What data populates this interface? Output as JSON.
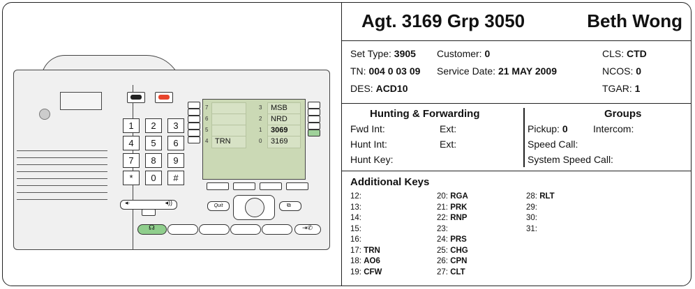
{
  "header": {
    "agent": "Agt. 3169 Grp 3050",
    "name": "Beth Wong"
  },
  "setinfo": {
    "set_type_label": "Set Type: ",
    "set_type": "3905",
    "customer_label": "Customer: ",
    "customer": "0",
    "cls_label": "CLS: ",
    "cls": "CTD",
    "tn_label": "TN: ",
    "tn": "004 0 03 09",
    "service_date_label": "Service Date: ",
    "service_date": "21 MAY 2009",
    "ncos_label": "NCOS: ",
    "ncos": "0",
    "des_label": "DES: ",
    "des": "ACD10",
    "tgar_label": "TGAR: ",
    "tgar": "1"
  },
  "hunting": {
    "title": "Hunting & Forwarding",
    "fwd_int": "Fwd  Int:",
    "fwd_ext": "Ext:",
    "hunt_int": "Hunt Int:",
    "hunt_ext": "Ext:",
    "hunt_key": "Hunt Key:"
  },
  "groups": {
    "title": "Groups",
    "pickup_label": "Pickup: ",
    "pickup": "0",
    "intercom": "Intercom:",
    "speed_call": "Speed Call:",
    "system_speed_call": "System Speed Call:"
  },
  "additional_keys": {
    "title": "Additional Keys",
    "col1": [
      {
        "n": "12:",
        "v": ""
      },
      {
        "n": "13:",
        "v": ""
      },
      {
        "n": "14:",
        "v": ""
      },
      {
        "n": "15:",
        "v": ""
      },
      {
        "n": "16:",
        "v": ""
      },
      {
        "n": "17: ",
        "v": "TRN"
      },
      {
        "n": "18: ",
        "v": "AO6"
      },
      {
        "n": "19: ",
        "v": "CFW"
      }
    ],
    "col2": [
      {
        "n": "20: ",
        "v": "RGA"
      },
      {
        "n": "21: ",
        "v": "PRK"
      },
      {
        "n": "22: ",
        "v": "RNP"
      },
      {
        "n": "23:",
        "v": ""
      },
      {
        "n": "24: ",
        "v": "PRS"
      },
      {
        "n": "25: ",
        "v": "CHG"
      },
      {
        "n": "26: ",
        "v": "CPN"
      },
      {
        "n": "27: ",
        "v": "CLT"
      }
    ],
    "col3": [
      {
        "n": "28: ",
        "v": "RLT"
      },
      {
        "n": "29:",
        "v": ""
      },
      {
        "n": "30:",
        "v": ""
      },
      {
        "n": "31:",
        "v": ""
      }
    ]
  },
  "phone": {
    "keypad": [
      "1",
      "2",
      "3",
      "4",
      "5",
      "6",
      "7",
      "8",
      "9",
      "*",
      "0",
      "#"
    ],
    "lcd_keys": [
      {
        "num": "7",
        "label": ""
      },
      {
        "num": "3",
        "label": "MSB"
      },
      {
        "num": "6",
        "label": ""
      },
      {
        "num": "2",
        "label": "NRD"
      },
      {
        "num": "5",
        "label": ""
      },
      {
        "num": "1",
        "label": "3069"
      },
      {
        "num": "4",
        "label": "TRN"
      },
      {
        "num": "0",
        "label": "3169"
      }
    ],
    "quit_label": "Quit"
  }
}
